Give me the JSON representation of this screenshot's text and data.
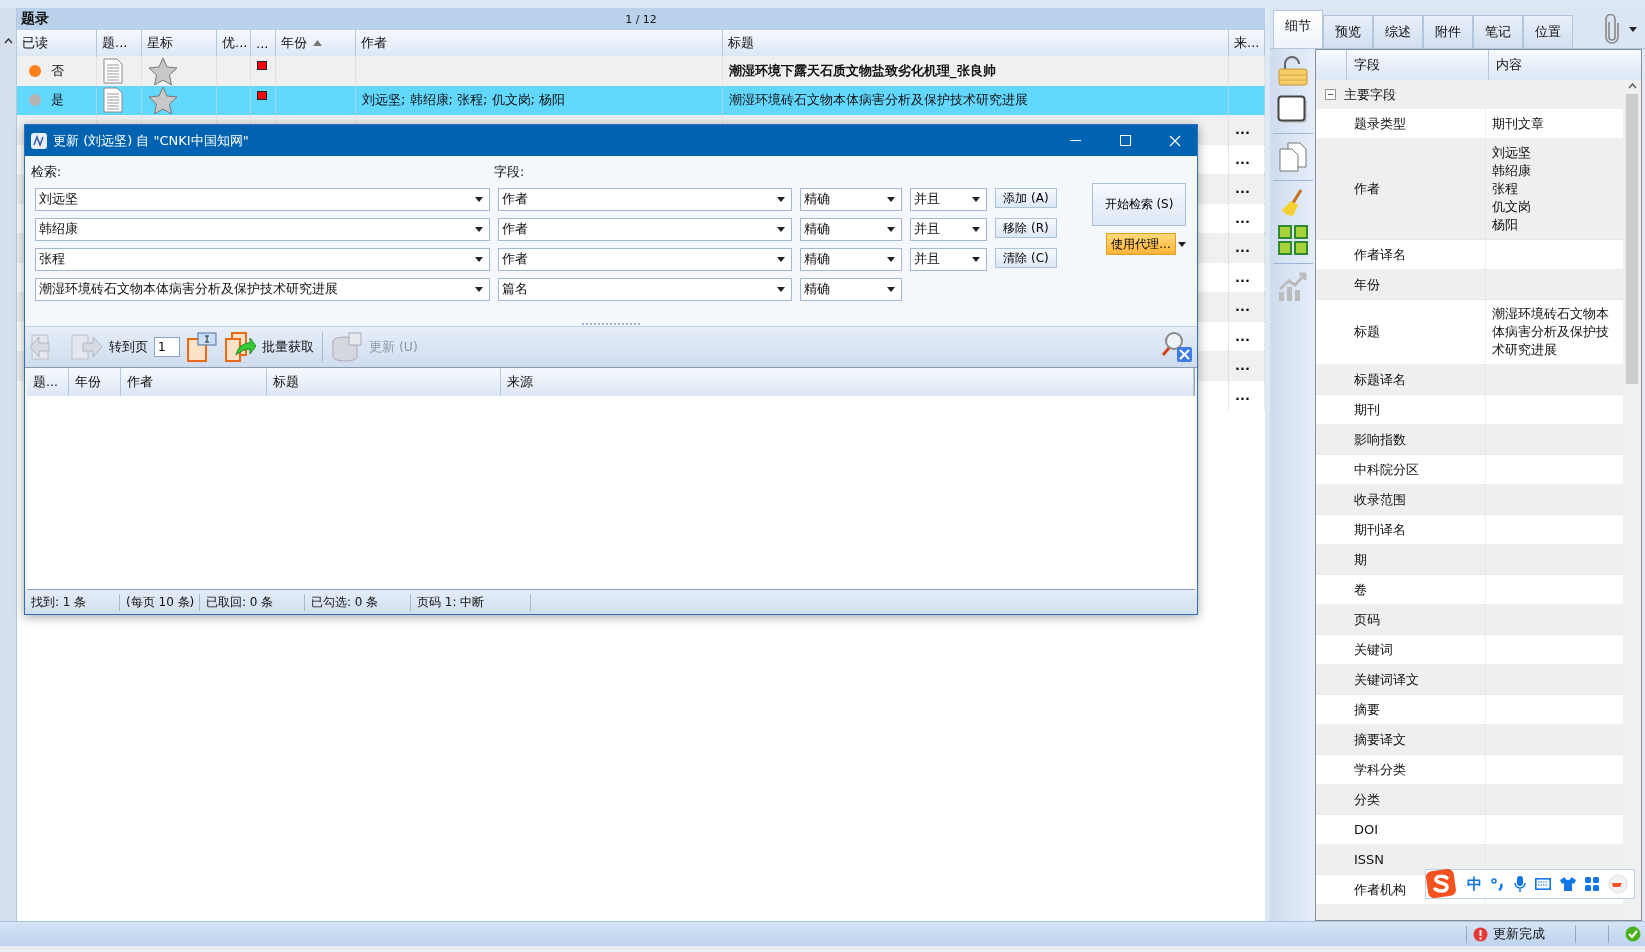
{
  "list": {
    "title": "题录",
    "page": "1 / 12",
    "columns": [
      {
        "label": "已读"
      },
      {
        "label": "题..."
      },
      {
        "label": "星标"
      },
      {
        "label": "优..."
      },
      {
        "label": "..."
      },
      {
        "label": "年份",
        "sorted": true
      },
      {
        "label": "作者"
      },
      {
        "label": "标题"
      },
      {
        "label": "来..."
      }
    ],
    "rows": [
      {
        "read": false,
        "read_label": "否",
        "starred": false,
        "flagged": true,
        "title": "潮湿环境下露天石质文物盐致劣化机理_张良帅",
        "selected": false
      },
      {
        "read": true,
        "read_label": "是",
        "starred": false,
        "flagged": true,
        "author": "刘远坚; 韩绍康; 张程; 仉文岗; 杨阳",
        "title": "潮湿环境砖石文物本体病害分析及保护技术研究进展",
        "selected": true
      },
      {
        "source": "...",
        "selected": false
      },
      {
        "source": "...",
        "selected": false
      },
      {
        "source": "...",
        "selected": false
      },
      {
        "source": "...",
        "selected": false
      },
      {
        "source": "...",
        "selected": false
      },
      {
        "source": "...",
        "selected": false
      },
      {
        "source": "...",
        "selected": false
      },
      {
        "source": "...",
        "selected": false
      },
      {
        "source": "...",
        "selected": false
      },
      {
        "source": "...",
        "selected": false
      }
    ]
  },
  "dialog": {
    "title": "更新 (刘远坚) 自 \"CNKI中国知网\"",
    "search_label": "检索:",
    "field_label": "字段:",
    "criteria": [
      {
        "term": "刘远坚",
        "field": "作者",
        "match": "精确",
        "logic": "并且"
      },
      {
        "term": "韩绍康",
        "field": "作者",
        "match": "精确",
        "logic": "并且"
      },
      {
        "term": "张程",
        "field": "作者",
        "match": "精确",
        "logic": "并且"
      },
      {
        "term": "潮湿环境砖石文物本体病害分析及保护技术研究进展",
        "field": "篇名",
        "match": "精确"
      }
    ],
    "row_buttons": [
      "添加 (A)",
      "移除 (R)",
      "清除 (C)"
    ],
    "search_button": "开始检索 (S)",
    "proxy_button": "使用代理...",
    "toolbar": {
      "nav_disabled": true,
      "goto_label": "转到页",
      "page": "1",
      "batch_label": "批量获取",
      "update_label": "更新 (U)",
      "update_disabled": true
    },
    "columns": [
      "题...",
      "年份",
      "作者",
      "标题",
      "来源"
    ],
    "status": [
      "找到: 1 条",
      "(每页 10 条)",
      "已取回: 0 条",
      "已勾选: 0 条",
      "页码 1: 中断"
    ]
  },
  "detail": {
    "tabs": [
      {
        "label": "细节",
        "selected": true
      },
      {
        "label": "预览",
        "selected": false
      },
      {
        "label": "综述",
        "selected": false
      },
      {
        "label": "附件",
        "selected": false
      },
      {
        "label": "笔记",
        "selected": false
      },
      {
        "label": "位置",
        "selected": false
      }
    ],
    "columns": [
      "字段",
      "内容"
    ],
    "group": {
      "label": "主要字段",
      "expanded": true,
      "fields": [
        {
          "name": "题录类型",
          "values": [
            "期刊文章"
          ]
        },
        {
          "name": "作者",
          "values": [
            "刘远坚",
            "韩绍康",
            "张程",
            "仉文岗",
            "杨阳"
          ]
        },
        {
          "name": "作者译名"
        },
        {
          "name": "年份"
        },
        {
          "name": "标题",
          "values": [
            "潮湿环境砖石文物本体病害分析及保护技术研究进展"
          ]
        },
        {
          "name": "标题译名"
        },
        {
          "name": "期刊"
        },
        {
          "name": "影响指数"
        },
        {
          "name": "中科院分区"
        },
        {
          "name": "收录范围"
        },
        {
          "name": "期刊译名"
        },
        {
          "name": "期"
        },
        {
          "name": "卷"
        },
        {
          "name": "页码"
        },
        {
          "name": "关键词"
        },
        {
          "name": "关键词译文"
        },
        {
          "name": "摘要"
        },
        {
          "name": "摘要译文"
        },
        {
          "name": "学科分类"
        },
        {
          "name": "分类"
        },
        {
          "name": "DOI"
        },
        {
          "name": "ISSN"
        },
        {
          "name": "作者机构"
        }
      ]
    }
  },
  "ime": {
    "mode": "中"
  },
  "status_bar": {
    "message": "更新完成"
  }
}
